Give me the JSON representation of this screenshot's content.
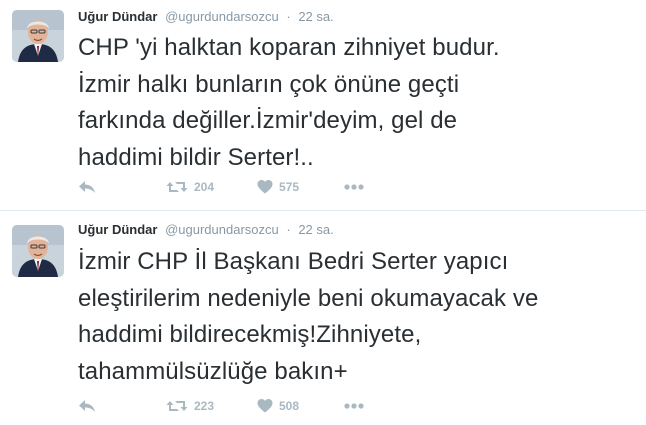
{
  "tweets": [
    {
      "fullname": "Uğur Dündar",
      "handle": "@ugurdundarsozcu",
      "separator": "·",
      "time": "22 sa.",
      "text_lines": [
        "CHP 'yi halktan koparan zihniyet budur.",
        "İzmir halkı bunların çok önüne geçti",
        "farkında değiller.İzmir'deyim, gel de",
        "haddimi bildir Serter!.."
      ],
      "retweets": "204",
      "likes": "575"
    },
    {
      "fullname": "Uğur Dündar",
      "handle": "@ugurdundarsozcu",
      "separator": "·",
      "time": "22 sa.",
      "text_lines": [
        "İzmir CHP İl Başkanı Bedri Serter yapıcı",
        "eleştirilerim nedeniyle beni okumayacak ve",
        "haddimi bildirecekmiş!Zihniyete,",
        "tahammülsüzlüğe bakın+"
      ],
      "retweets": "223",
      "likes": "508"
    }
  ],
  "icons": {
    "reply": "reply-icon",
    "retweet": "retweet-icon",
    "like": "heart-icon",
    "more": "more-dots-icon"
  },
  "colors": {
    "text": "#292f33",
    "secondary": "#8899a6",
    "action_icons": "#aab8c2",
    "divider": "#e1e8ed"
  }
}
